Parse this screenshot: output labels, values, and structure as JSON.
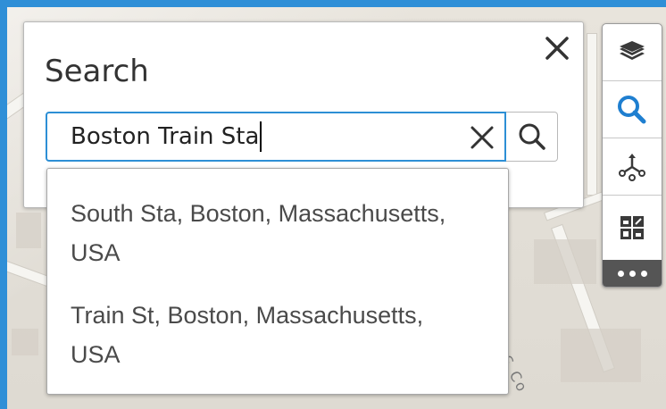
{
  "search_panel": {
    "title": "Search",
    "input_value": "Boston Train Sta",
    "close_icon": "close-icon",
    "clear_icon": "clear-icon",
    "search_icon": "search-icon"
  },
  "suggestions": [
    {
      "line1": "South Sta, Boston, Massachusetts,",
      "line2": "USA"
    },
    {
      "line1": "Train St, Boston, Massachusetts,",
      "line2": "USA"
    }
  ],
  "widget_bar": {
    "items": [
      {
        "icon": "layers-icon"
      },
      {
        "icon": "search-icon",
        "active": true
      },
      {
        "icon": "measure-icon"
      },
      {
        "icon": "basemap-gallery-icon"
      },
      {
        "icon": "more-icon"
      }
    ]
  },
  "map": {
    "visible_label": "US Co"
  },
  "colors": {
    "accent": "#2d8fd5",
    "frame": "#2f8fd7",
    "more_button": "#555555"
  }
}
